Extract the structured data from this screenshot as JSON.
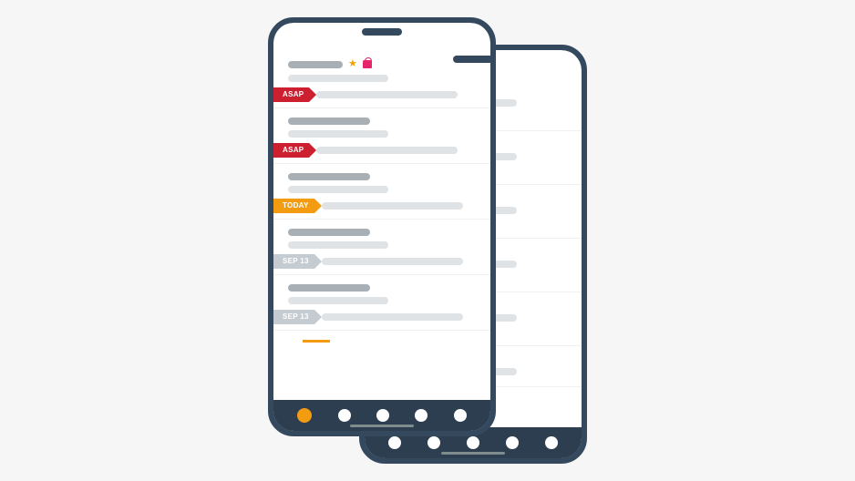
{
  "tags": {
    "asap": "ASAP",
    "today": "TODAY",
    "sep13": "SEP 13"
  },
  "icons": {
    "star": "★"
  },
  "nav": {
    "count": 5,
    "active": 0
  }
}
